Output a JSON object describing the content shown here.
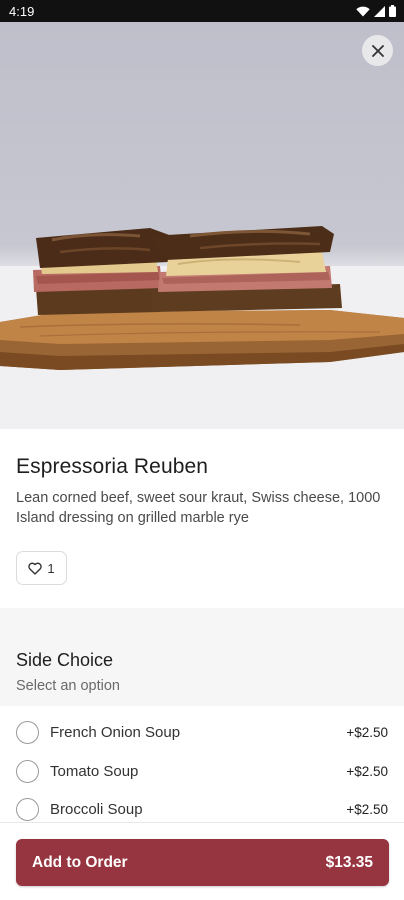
{
  "status_bar": {
    "time": "4:19"
  },
  "product": {
    "name": "Espressoria Reuben",
    "description": "Lean corned beef, sweet sour kraut, Swiss cheese, 1000 Island dressing on grilled marble rye",
    "favorite_count": "1"
  },
  "side_choice": {
    "title": "Side Choice",
    "subtitle": "Select an option",
    "options": [
      {
        "label": "French Onion Soup",
        "price": "+$2.50"
      },
      {
        "label": "Tomato Soup",
        "price": "+$2.50"
      },
      {
        "label": "Broccoli Soup",
        "price": "+$2.50"
      }
    ]
  },
  "footer": {
    "add_label": "Add to Order",
    "total": "$13.35"
  },
  "colors": {
    "accent": "#96343f",
    "status_bar": "#111111"
  },
  "icons": {
    "close": "close-icon",
    "favorite": "heart-icon",
    "wifi": "wifi-icon",
    "signal": "signal-icon",
    "battery": "battery-icon"
  }
}
